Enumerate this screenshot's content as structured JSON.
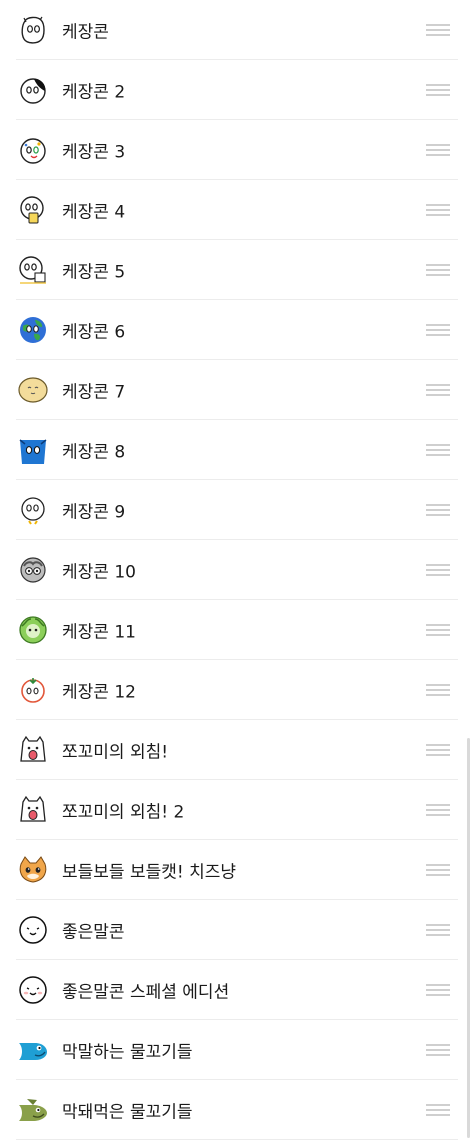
{
  "packs": [
    {
      "label": "케장콘",
      "icon": "face-doodle-icon"
    },
    {
      "label": "케장콘 2",
      "icon": "face-black-patch-icon"
    },
    {
      "label": "케장콘 3",
      "icon": "face-colorful-icon"
    },
    {
      "label": "케장콘 4",
      "icon": "face-yellow-cup-icon"
    },
    {
      "label": "케장콘 5",
      "icon": "face-holding-box-icon"
    },
    {
      "label": "케장콘 6",
      "icon": "earth-face-icon"
    },
    {
      "label": "케장콘 7",
      "icon": "yellow-blob-face-icon"
    },
    {
      "label": "케장콘 8",
      "icon": "blue-cup-face-icon"
    },
    {
      "label": "케장콘 9",
      "icon": "chick-face-icon"
    },
    {
      "label": "케장콘 10",
      "icon": "gray-swirl-face-icon"
    },
    {
      "label": "케장콘 11",
      "icon": "cabbage-face-icon"
    },
    {
      "label": "케장콘 12",
      "icon": "tomato-face-icon"
    },
    {
      "label": "쪼꼬미의 외침!",
      "icon": "shouting-creature-icon"
    },
    {
      "label": "쪼꼬미의 외침! 2",
      "icon": "shouting-creature-2-icon"
    },
    {
      "label": "보들보들 보들캣! 치즈냥",
      "icon": "cheese-cat-icon"
    },
    {
      "label": "좋은말콘",
      "icon": "smile-face-icon"
    },
    {
      "label": "좋은말콘 스페셜 에디션",
      "icon": "smile-face-special-icon"
    },
    {
      "label": "막말하는 물꼬기들",
      "icon": "blue-fish-icon"
    },
    {
      "label": "막돼먹은 물꼬기들",
      "icon": "green-fish-icon"
    }
  ]
}
